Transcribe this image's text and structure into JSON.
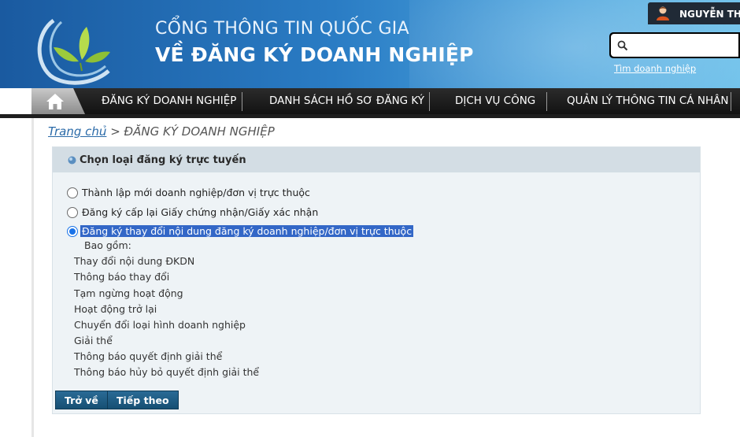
{
  "header": {
    "title_line1": "CỔNG THÔNG TIN QUỐC GIA",
    "title_line2": "VỀ ĐĂNG KÝ DOANH NGHIỆP",
    "user_name": "NGUYỄN THỊ T",
    "search_placeholder": "",
    "find_link": "Tìm doanh nghiệp"
  },
  "nav": {
    "home_icon": "home-icon",
    "items": [
      "ĐĂNG KÝ DOANH NGHIỆP",
      "DANH SÁCH HỒ SƠ ĐĂNG KÝ",
      "DỊCH VỤ CÔNG",
      "QUẢN LÝ THÔNG TIN CÁ NHÂN"
    ]
  },
  "breadcrumb": {
    "home": "Trang chủ",
    "separator": " > ",
    "current": "ĐĂNG KÝ DOANH NGHIỆP"
  },
  "panel": {
    "title": "Chọn loại đăng ký trực tuyến",
    "options": [
      {
        "label": "Thành lập mới doanh nghiệp/đơn vị trực thuộc",
        "checked": false
      },
      {
        "label": "Đăng ký cấp lại Giấy chứng nhận/Giấy xác nhận",
        "checked": false
      },
      {
        "label": "Đăng ký thay đổi nội dung đăng ký doanh nghiệp/đơn vị trực thuộc",
        "checked": true
      }
    ],
    "includes_label": "Bao gồm:",
    "sub_items": [
      "Thay đổi nội dung ĐKDN",
      "Thông báo thay đổi",
      "Tạm ngừng hoạt động",
      "Hoạt động trở lại",
      "Chuyển đổi loại hình doanh nghiệp",
      "Giải thể",
      "Thông báo quyết định giải thể",
      "Thông báo hủy bỏ quyết định giải thể"
    ],
    "back_button": "Trở về",
    "next_button": "Tiếp theo"
  },
  "colors": {
    "header_start": "#1a5aa0",
    "header_end": "#6cc0ea",
    "button": "#1d5a82",
    "selection": "#3367c7"
  }
}
